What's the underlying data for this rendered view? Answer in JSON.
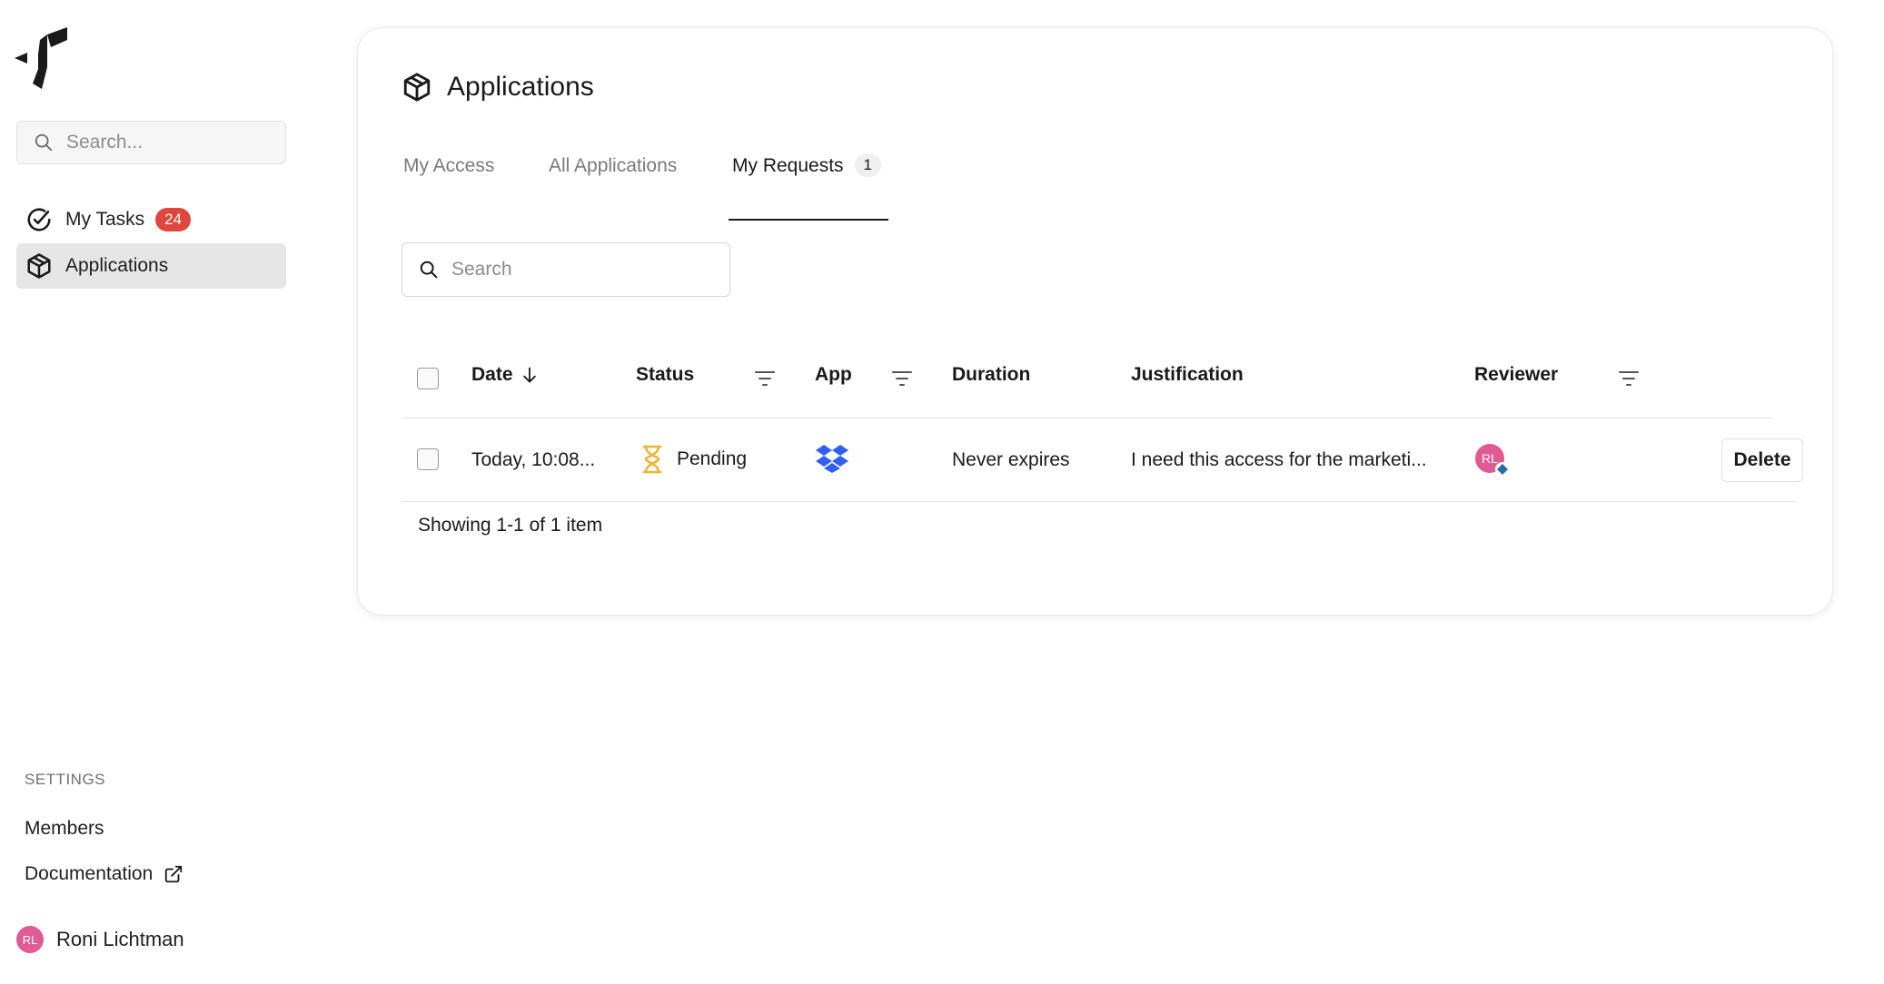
{
  "sidebar": {
    "search_placeholder": "Search...",
    "items": [
      {
        "label": "My Tasks",
        "badge": "24",
        "icon": "check-circle-icon"
      },
      {
        "label": "Applications",
        "icon": "box-icon"
      }
    ],
    "settings_label": "SETTINGS",
    "links": [
      {
        "label": "Members"
      },
      {
        "label": "Documentation",
        "icon": "external-link-icon"
      }
    ],
    "user": {
      "initials": "RL",
      "name": "Roni Lichtman"
    }
  },
  "main": {
    "title": "Applications",
    "tabs": [
      {
        "label": "My Access"
      },
      {
        "label": "All Applications"
      },
      {
        "label": "My Requests",
        "count": "1",
        "active": true
      }
    ],
    "search_placeholder": "Search",
    "columns": {
      "date": "Date",
      "status": "Status",
      "app": "App",
      "duration": "Duration",
      "justification": "Justification",
      "reviewer": "Reviewer"
    },
    "rows": [
      {
        "date": "Today, 10:08...",
        "status": "Pending",
        "app_icon": "dropbox-icon",
        "duration": "Never expires",
        "justification": "I need this access for the marketi...",
        "reviewer_initials": "RL",
        "action": "Delete"
      }
    ],
    "pagination": "Showing 1-1 of 1 item"
  },
  "colors": {
    "badge": "#e0463c",
    "avatar": "#e05a93",
    "pending": "#f2b233",
    "dropbox": "#2f5ff5"
  }
}
